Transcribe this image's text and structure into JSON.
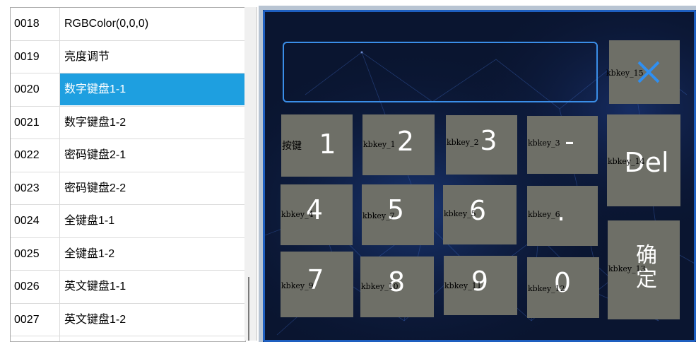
{
  "list": {
    "rows": [
      {
        "id": "0018",
        "name": "RGBColor(0,0,0)"
      },
      {
        "id": "0019",
        "name": "亮度调节"
      },
      {
        "id": "0020",
        "name": "数字键盘1-1",
        "selected": true
      },
      {
        "id": "0021",
        "name": "数字键盘1-2"
      },
      {
        "id": "0022",
        "name": "密码键盘2-1"
      },
      {
        "id": "0023",
        "name": "密码键盘2-2"
      },
      {
        "id": "0024",
        "name": "全键盘1-1"
      },
      {
        "id": "0025",
        "name": "全键盘1-2"
      },
      {
        "id": "0026",
        "name": "英文键盘1-1"
      },
      {
        "id": "0027",
        "name": "英文键盘1-2"
      }
    ],
    "selected_color": "#1e9fe0"
  },
  "keypad": {
    "display_value": "",
    "accent": "#3a8ee8",
    "key_color": "#6e6f67",
    "keys": {
      "k1": {
        "big": "1",
        "label": "按键"
      },
      "k2": {
        "big": "2",
        "label": "kbkey_1"
      },
      "k3": {
        "big": "3",
        "label": "kbkey_2"
      },
      "kdash": {
        "big": "-",
        "label": "kbkey_3"
      },
      "k4": {
        "big": "4",
        "label": "kbkey_4"
      },
      "k5": {
        "big": "5",
        "label": "kbkey_7"
      },
      "k6": {
        "big": "6",
        "label": "kbkey_5"
      },
      "kdot": {
        "big": ".",
        "label": "kbkey_6"
      },
      "k7": {
        "big": "7",
        "label": "kbkey_9"
      },
      "k8": {
        "big": "8",
        "label": "kbkey_10"
      },
      "k9": {
        "big": "9",
        "label": "kbkey_11"
      },
      "k0": {
        "big": "0",
        "label": "kbkey_12"
      },
      "kclose": {
        "icon": "close-icon",
        "label": "kbkey_15"
      },
      "kdel": {
        "big": "Del",
        "label": "kbkey_14"
      },
      "kok": {
        "big1": "确",
        "big2": "定",
        "label": "kbkey_13"
      }
    }
  }
}
